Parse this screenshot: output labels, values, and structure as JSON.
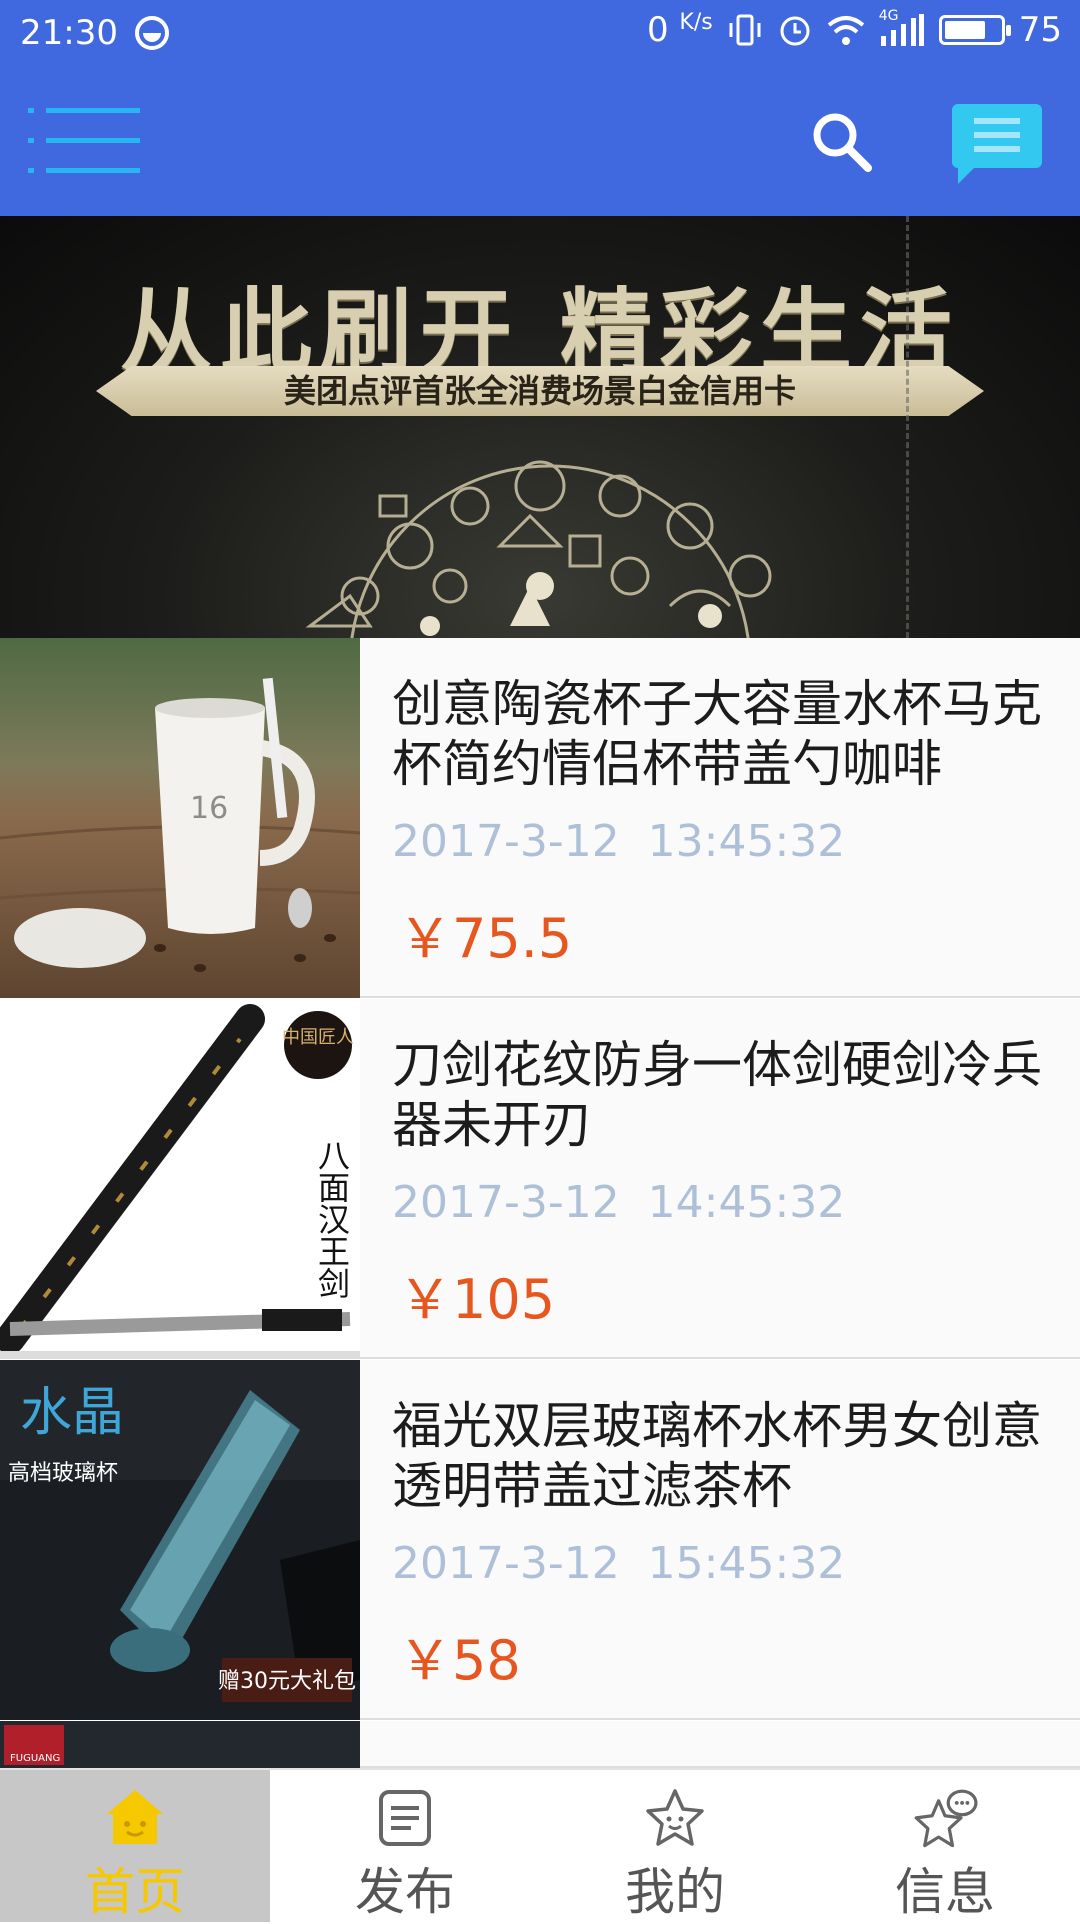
{
  "status_bar": {
    "time": "21:30",
    "net_speed": "0",
    "net_unit": "K/s",
    "signal_type": "4G",
    "battery": "75",
    "battery_level": 0.75
  },
  "app_bar": {
    "menu_icon": "menu-icon",
    "search_icon": "search-icon",
    "message_icon": "message-icon",
    "color": "#4169df"
  },
  "banner": {
    "title": "从此刷开 精彩生活",
    "subtitle": "美团点评首张全消费场景白金信用卡"
  },
  "items": [
    {
      "title": "创意陶瓷杯子大容量水杯马克杯简约情侣杯带盖勺咖啡",
      "time": "2017-3-12  13:45:32",
      "price": "￥75.5",
      "image_text": "16"
    },
    {
      "title": "刀剑花纹防身一体剑硬剑冷兵器未开刃",
      "time": "2017-3-12  14:45:32",
      "price": "￥105",
      "image_text": "八面汉王剑",
      "image_badge": "中国匠人"
    },
    {
      "title": "福光双层玻璃杯水杯男女创意透明带盖过滤茶杯",
      "time": "2017-3-12  15:45:32",
      "price": "￥58",
      "image_text": "水晶",
      "image_sub": "高档玻璃杯",
      "image_promo": "赠30元大礼包"
    }
  ],
  "peek_item": {
    "image_text": "FUGUANG"
  },
  "bottom_nav": [
    {
      "label": "首页",
      "icon": "home-icon",
      "active": true
    },
    {
      "label": "发布",
      "icon": "publish-icon",
      "active": false
    },
    {
      "label": "我的",
      "icon": "star-face-icon",
      "active": false
    },
    {
      "label": "信息",
      "icon": "chat-icon",
      "active": false
    }
  ],
  "colors": {
    "primary": "#4169df",
    "price": "#e8561f",
    "time": "#adc0d8",
    "active_tab": "#f5c800"
  }
}
